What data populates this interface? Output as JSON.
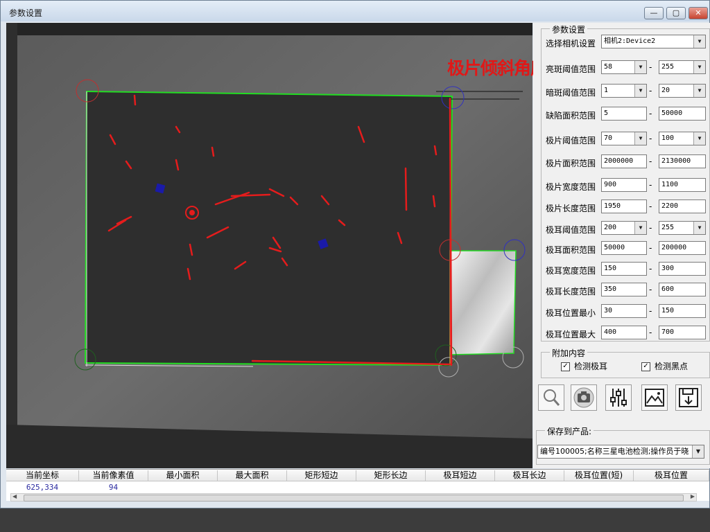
{
  "window": {
    "title": "参数设置",
    "minimize_glyph": "—",
    "maximize_glyph": "▢",
    "close_glyph": "✕"
  },
  "overlay": {
    "title": "极片倾斜角度测量"
  },
  "params": {
    "legend": "参数设置",
    "camera_label": "选择相机设置",
    "camera_value": "相机2:Device2",
    "rows": [
      {
        "label": "亮斑阈值范围",
        "min": "58",
        "max": "255",
        "type": "dropdown"
      },
      {
        "label": "暗斑阈值范围",
        "min": "1",
        "max": "20",
        "type": "dropdown"
      },
      {
        "label": "缺陷面积范围",
        "min": "5",
        "max": "50000",
        "type": "text"
      },
      {
        "label": "极片阈值范围",
        "min": "70",
        "max": "100",
        "type": "dropdown"
      },
      {
        "label": "极片面积范围",
        "min": "2000000",
        "max": "2130000",
        "type": "text"
      },
      {
        "label": "极片宽度范围",
        "min": "900",
        "max": "1100",
        "type": "text"
      },
      {
        "label": "极片长度范围",
        "min": "1950",
        "max": "2200",
        "type": "text"
      },
      {
        "label": "极耳阈值范围",
        "min": "200",
        "max": "255",
        "type": "dropdown"
      },
      {
        "label": "极耳面积范围",
        "min": "50000",
        "max": "200000",
        "type": "text"
      },
      {
        "label": "极耳宽度范围",
        "min": "150",
        "max": "300",
        "type": "text"
      },
      {
        "label": "极耳长度范围",
        "min": "350",
        "max": "600",
        "type": "text"
      },
      {
        "label": "极耳位置最小",
        "min": "30",
        "max": "150",
        "type": "text"
      },
      {
        "label": "极耳位置最大",
        "min": "400",
        "max": "700",
        "type": "text"
      }
    ]
  },
  "extra": {
    "legend": "附加内容",
    "detect_tab_label": "检测极耳",
    "detect_tab_checked": true,
    "detect_spot_label": "检测黑点",
    "detect_spot_checked": true
  },
  "toolbar": {
    "icons": [
      "magnifier-icon",
      "camera-icon",
      "sliders-icon",
      "image-icon",
      "save-icon"
    ]
  },
  "save": {
    "legend": "保存到产品:",
    "value": "编号100005;名称三星电池检测;操作员于晓"
  },
  "grid": {
    "columns": [
      "当前坐标",
      "当前像素值",
      "最小面积",
      "最大面积",
      "矩形短边",
      "矩形长边",
      "极耳短边",
      "极耳长边",
      "极耳位置(短)",
      "极耳位置"
    ],
    "row": [
      "625,334",
      "94",
      "",
      "",
      "",
      "",
      "",
      "",
      "",
      ""
    ]
  },
  "colors": {
    "accent_red": "#e01818",
    "detect_green": "#22dd22",
    "blob_blue": "#1a1aa8"
  }
}
